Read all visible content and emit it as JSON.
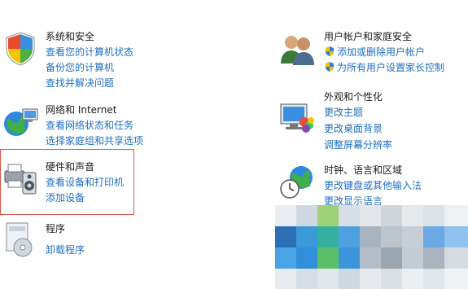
{
  "left": [
    {
      "id": "system-security",
      "title": "系统和安全",
      "links": [
        "查看您的计算机状态",
        "备份您的计算机",
        "查找并解决问题"
      ]
    },
    {
      "id": "network-internet",
      "title": "网络和 Internet",
      "links": [
        "查看网络状态和任务",
        "选择家庭组和共享选项"
      ]
    },
    {
      "id": "hardware-sound",
      "title": "硬件和声音",
      "links": [
        "查看设备和打印机",
        "添加设备"
      ]
    },
    {
      "id": "programs",
      "title": "程序",
      "links": [
        "卸载程序"
      ]
    }
  ],
  "right": [
    {
      "id": "user-accounts",
      "title": "用户帐户和家庭安全",
      "links": [
        "添加或删除用户帐户",
        "为所有用户设置家长控制"
      ]
    },
    {
      "id": "appearance",
      "title": "外观和个性化",
      "links": [
        "更改主题",
        "更改桌面背景",
        "调整屏幕分辨率"
      ]
    },
    {
      "id": "clock-language",
      "title": "时钟、语言和区域",
      "links": [
        "更改键盘或其他输入法",
        "更改显示语言"
      ]
    }
  ],
  "colors": {
    "link": "#1f6fbf",
    "highlight": "#d9534f"
  }
}
